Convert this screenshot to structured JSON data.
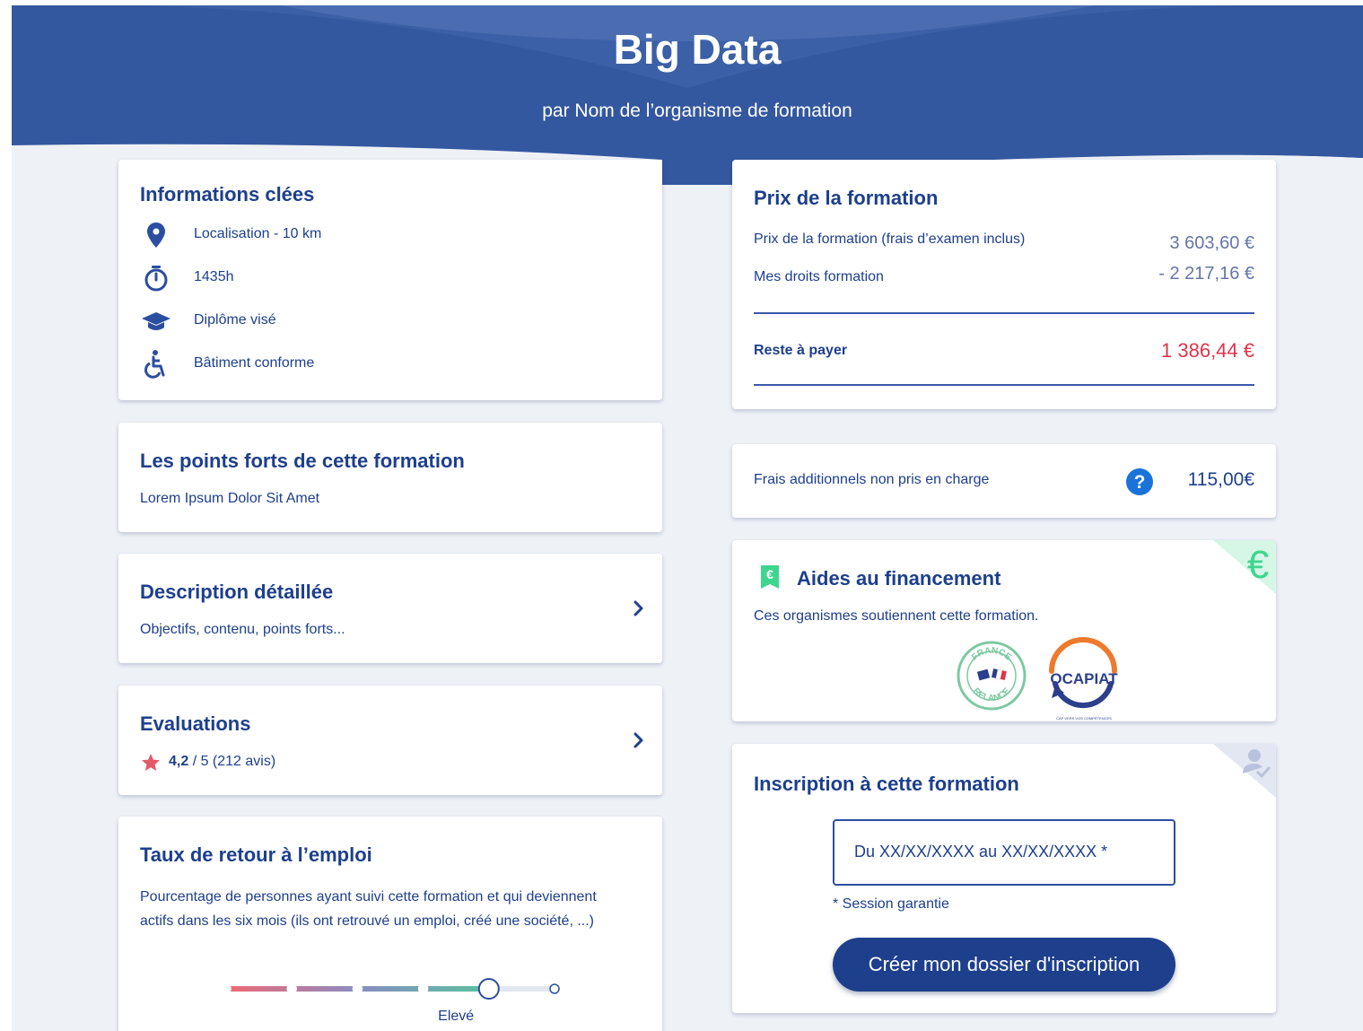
{
  "hero": {
    "title": "Big Data",
    "subtitle": "par Nom de l’organisme de formation"
  },
  "key_info": {
    "title": "Informations clées",
    "items": [
      {
        "icon": "map-pin-icon",
        "label": "Localisation - 10 km"
      },
      {
        "icon": "stopwatch-icon",
        "label": "1435h"
      },
      {
        "icon": "graduation-cap-icon",
        "label": "Diplôme visé"
      },
      {
        "icon": "accessibility-icon",
        "label": "Bâtiment conforme"
      }
    ]
  },
  "strengths": {
    "title": "Les points forts de cette formation",
    "text": "Lorem Ipsum Dolor Sit Amet"
  },
  "description": {
    "title": "Description détaillée",
    "text": "Objectifs, contenu, points forts..."
  },
  "evaluations": {
    "title": "Evaluations",
    "score": "4,2",
    "rest": " / 5 (212 avis)"
  },
  "employment": {
    "title": "Taux de retour à l’emploi",
    "text_line1": "Pourcentage de personnes ayant suivi cette formation et qui deviennent",
    "text_line2": "actifs dans les six mois (ils ont retrouvé un emploi, créé une société, ...)",
    "level_label": "Elevé",
    "level_index": 4,
    "level_count": 6
  },
  "price": {
    "title": "Prix de la formation",
    "rows": [
      {
        "label": "Prix de la formation (frais d’examen inclus)",
        "value": "3 603,60 €"
      },
      {
        "label": "Mes droits formation",
        "value": "- 2 217,16 €"
      }
    ],
    "total_label": "Reste à payer",
    "total_value": "1 386,44 €"
  },
  "extra_fees": {
    "label": "Frais additionnels non pris en charge",
    "value": "115,00€"
  },
  "funding": {
    "title": "Aides au financement",
    "text": "Ces organismes soutiennent cette formation.",
    "logo1_text": "FRANCE RELANCE",
    "logo2_text": "OCAPIAT",
    "logo2_tagline": "CAP VERS VOS COMPÉTENCES"
  },
  "registration": {
    "title": "Inscription à cette formation",
    "session_value": "Du XX/XX/XXXX au XX/XX/XXXX *",
    "guarantee_note": "* Session garantie",
    "button_label": "Créer mon dossier d'inscription"
  },
  "colors": {
    "brand": "#1d3f8c",
    "hero": "#34589f",
    "accent_red": "#e0344a",
    "accent_green": "#3ed68e",
    "help_blue": "#1a73d9"
  }
}
